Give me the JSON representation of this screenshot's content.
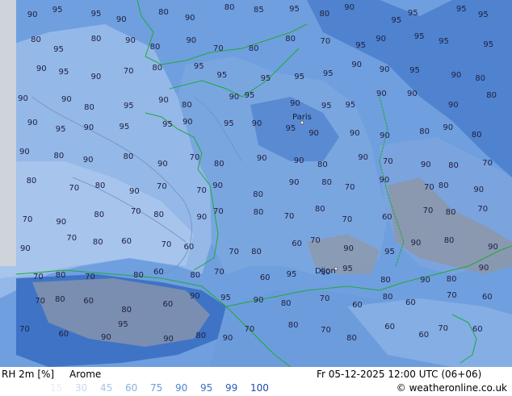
{
  "header": {
    "param": "RH 2m [%]",
    "model": "Arome",
    "datetime": "Fr 05-12-2025 12:00 UTC (06+06)"
  },
  "legend": [
    {
      "value": "15",
      "color": "#e6ecf6"
    },
    {
      "value": "30",
      "color": "#c8d7ee"
    },
    {
      "value": "45",
      "color": "#aac2e6"
    },
    {
      "value": "60",
      "color": "#8cb0de"
    },
    {
      "value": "75",
      "color": "#6e9bd6"
    },
    {
      "value": "90",
      "color": "#5085ce"
    },
    {
      "value": "95",
      "color": "#3a6fc4"
    },
    {
      "value": "99",
      "color": "#2a5bb8"
    },
    {
      "value": "100",
      "color": "#1d49a8"
    }
  ],
  "copyright": "weatheronline.co.uk",
  "places": [
    "Paris",
    "Dijon"
  ],
  "map_labels": [
    "90",
    "95",
    "95",
    "90",
    "80",
    "90",
    "80",
    "85",
    "95",
    "80",
    "90",
    "95",
    "95",
    "95",
    "95",
    "80",
    "95",
    "80",
    "90",
    "80",
    "90",
    "70",
    "80",
    "80",
    "70",
    "95",
    "90",
    "95",
    "95",
    "95",
    "90",
    "95",
    "90",
    "70",
    "80",
    "95",
    "95",
    "95",
    "95",
    "95",
    "90",
    "90",
    "95",
    "90",
    "80",
    "90",
    "90",
    "80",
    "95",
    "90",
    "80",
    "90",
    "95",
    "90",
    "95",
    "95",
    "90",
    "90",
    "90",
    "80",
    "90",
    "95",
    "90",
    "95",
    "95",
    "90",
    "95",
    "90",
    "95",
    "90",
    "90",
    "90",
    "80",
    "90",
    "80",
    "90",
    "80",
    "90",
    "80",
    "90",
    "70",
    "80",
    "90",
    "90",
    "80",
    "90",
    "70",
    "90",
    "80",
    "70",
    "80",
    "70",
    "80",
    "90",
    "70",
    "70",
    "90",
    "80",
    "90",
    "80",
    "70",
    "90",
    "70",
    "80",
    "90",
    "70",
    "90",
    "80",
    "70",
    "80",
    "90",
    "70",
    "80",
    "70",
    "80",
    "70",
    "60",
    "70",
    "80",
    "70",
    "90",
    "70",
    "80",
    "60",
    "70",
    "60",
    "70",
    "80",
    "60",
    "70",
    "90",
    "95",
    "90",
    "80",
    "90",
    "70",
    "80",
    "70",
    "80",
    "60",
    "80",
    "70",
    "60",
    "95",
    "90",
    "95",
    "80",
    "90",
    "80",
    "90",
    "70",
    "80",
    "60",
    "80",
    "60",
    "90",
    "95",
    "90",
    "80",
    "70",
    "60",
    "80",
    "60",
    "70",
    "60",
    "70",
    "60",
    "90",
    "95",
    "90",
    "80",
    "90",
    "70",
    "80",
    "70",
    "80",
    "60",
    "60",
    "70",
    "60"
  ]
}
